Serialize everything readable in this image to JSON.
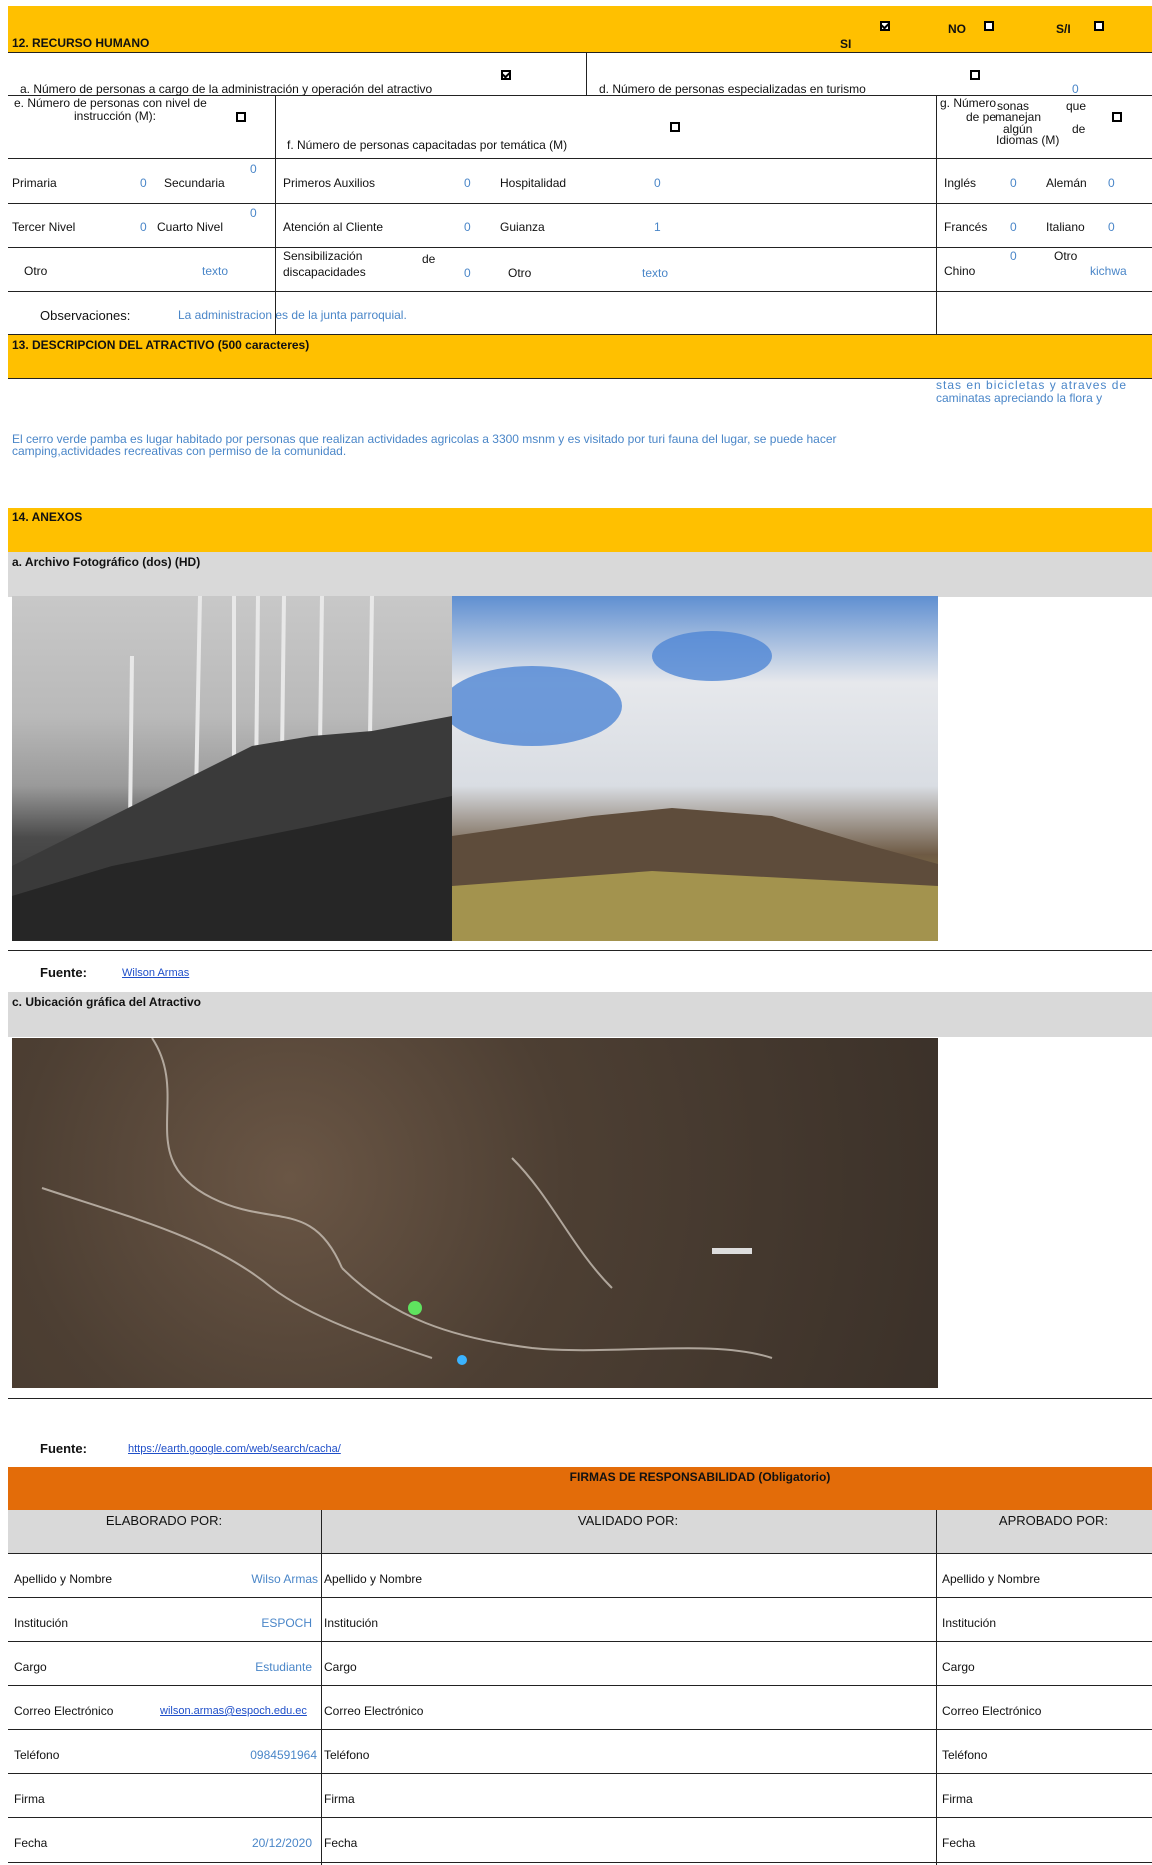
{
  "section12": {
    "title": "12. RECURSO HUMANO",
    "si": "SI",
    "no": "NO",
    "sn": "S/I",
    "a_label": "a. Número de personas a cargo de la administración y operación del atractivo",
    "d_label": "d. Número de personas especializadas en turismo",
    "d_value": "0",
    "e_label_1": "e. Número de personas con nivel de",
    "e_label_2": "instrucción (M):",
    "f_label": "f. Número de personas capacitadas por temática (M)",
    "g_label_1": "g. Número",
    "g_label_1b": "sonas",
    "g_label_1c": "que",
    "g_label_2": "de pe",
    "g_label_2b": "manejan",
    "g_label_3": "algún",
    "g_label_3b": "de",
    "g_label_4": "Idiomas (M)",
    "primaria": "Primaria",
    "primaria_v": "0",
    "secundaria": "Secundaria",
    "secundaria_v": "0",
    "tercer": "Tercer Nivel",
    "tercer_v": "0",
    "cuarto": "Cuarto Nivel",
    "cuarto_v": "0",
    "otro": "Otro",
    "otro_v": "texto",
    "primeros": "Primeros Auxilios",
    "primeros_v": "0",
    "hospitalidad": "Hospitalidad",
    "hospitalidad_v": "0",
    "atencion": "Atención al Cliente",
    "atencion_v": "0",
    "guianza": "Guianza",
    "guianza_v": "1",
    "sensib_1": "Sensibilización",
    "sensib_de": "de",
    "sensib_2": "discapacidades",
    "sensib_v": "0",
    "otro2": "Otro",
    "otro2_v": "texto",
    "ingles": "Inglés",
    "ingles_v": "0",
    "aleman": "Alemán",
    "aleman_v": "0",
    "frances": "Francés",
    "frances_v": "0",
    "italiano": "Italiano",
    "italiano_v": "0",
    "chino": "Chino",
    "chino_v": "0",
    "otro3": "Otro",
    "otro3_v": "kichwa",
    "obs_label": "Observaciones:",
    "obs_value": "La administracion es de la junta parroquial."
  },
  "section13": {
    "title": "13. DESCRIPCION DEL ATRACTIVO (500 caracteres)",
    "right_1": "stas en bicicletas y atraves de",
    "right_2": "caminatas apreciando la flora y",
    "desc_1": "El cerro verde pamba es lugar habitado por personas que realizan actividades agricolas a 3300 msnm y es visitado por turi fauna del lugar, se puede hacer",
    "desc_2": "camping,actividades recreativas con permiso de la comunidad."
  },
  "section14": {
    "title": "14. ANEXOS",
    "photo_title": "a. Archivo Fotográfico (dos) (HD)",
    "fuente_label": "Fuente:",
    "fuente_1": "Wilson Armas",
    "map_title": "c. Ubicación gráfica del Atractivo",
    "fuente_2": "https://earth.google.com/web/search/cacha/"
  },
  "firmas": {
    "title": "FIRMAS DE RESPONSABILIDAD (Obligatorio)",
    "elaborado": "ELABORADO POR:",
    "validado": "VALIDADO  POR:",
    "aprobado": "APROBADO POR:",
    "rows": [
      {
        "label": "Apellido y Nombre",
        "value": "Wilso Armas"
      },
      {
        "label": "Institución",
        "value": "ESPOCH"
      },
      {
        "label": "Cargo",
        "value": "Estudiante"
      },
      {
        "label": "Correo Electrónico",
        "value": "wilson.armas@espoch.edu.ec"
      },
      {
        "label": "Teléfono",
        "value": "0984591964"
      },
      {
        "label": "Firma",
        "value": ""
      },
      {
        "label": "Fecha",
        "value": "20/12/2020"
      }
    ]
  },
  "colors": {
    "header": "#ffc000",
    "orange": "#e36c09",
    "grey": "#d9d9d9",
    "blue": "#4a86c8"
  }
}
